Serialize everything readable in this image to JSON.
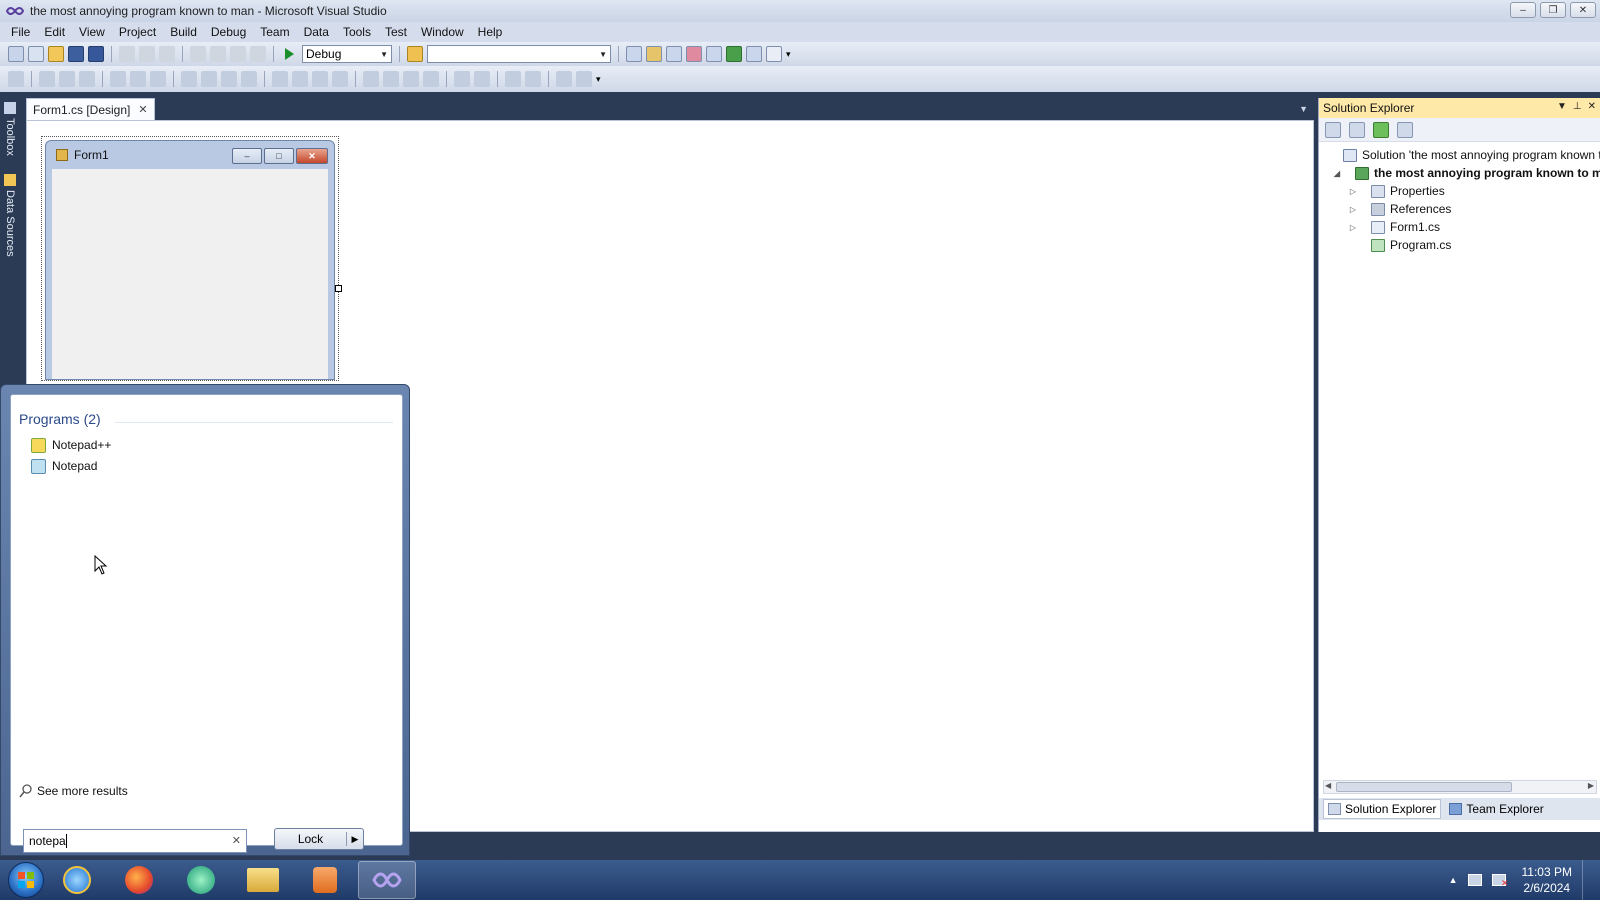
{
  "window": {
    "title": "the most annoying program known to man - Microsoft Visual Studio"
  },
  "menu": [
    "File",
    "Edit",
    "View",
    "Project",
    "Build",
    "Debug",
    "Team",
    "Data",
    "Tools",
    "Test",
    "Window",
    "Help"
  ],
  "toolbar": {
    "config_value": "Debug",
    "platform_value": ""
  },
  "leftrail": {
    "toolbox_label": "Toolbox",
    "datasources_label": "Data Sources"
  },
  "document": {
    "tab_label": "Form1.cs [Design]",
    "form_title": "Form1"
  },
  "solution_explorer": {
    "title": "Solution Explorer",
    "tree": [
      {
        "label": "Solution 'the most annoying program known t",
        "level": 0,
        "expander": "",
        "icon": "solution-icon",
        "bold": false
      },
      {
        "label": "the most annoying program known to m",
        "level": 1,
        "expander": "◢",
        "icon": "project-icon",
        "bold": true
      },
      {
        "label": "Properties",
        "level": 2,
        "expander": "▷",
        "icon": "properties-icon",
        "bold": false
      },
      {
        "label": "References",
        "level": 2,
        "expander": "▷",
        "icon": "references-icon",
        "bold": false
      },
      {
        "label": "Form1.cs",
        "level": 2,
        "expander": "▷",
        "icon": "form-file-icon",
        "bold": false
      },
      {
        "label": "Program.cs",
        "level": 2,
        "expander": "",
        "icon": "cs-file-icon",
        "bold": false
      }
    ],
    "bottom_tabs": [
      "Solution Explorer",
      "Team Explorer"
    ]
  },
  "start_menu": {
    "section_heading": "Programs (2)",
    "programs": [
      "Notepad++",
      "Notepad"
    ],
    "see_more": "See more results",
    "search_value": "notepa",
    "lock_label": "Lock"
  },
  "taskbar": {
    "apps": [
      "internet-explorer-icon",
      "firefox-icon",
      "messenger-icon",
      "file-explorer-icon",
      "media-player-icon",
      "visual-studio-icon"
    ],
    "time": "11:03 PM",
    "date": "2/6/2024"
  },
  "colors": {
    "accent": "#2b3b55",
    "se_header": "#ffe9a8",
    "taskbar": "#1f3a68"
  }
}
